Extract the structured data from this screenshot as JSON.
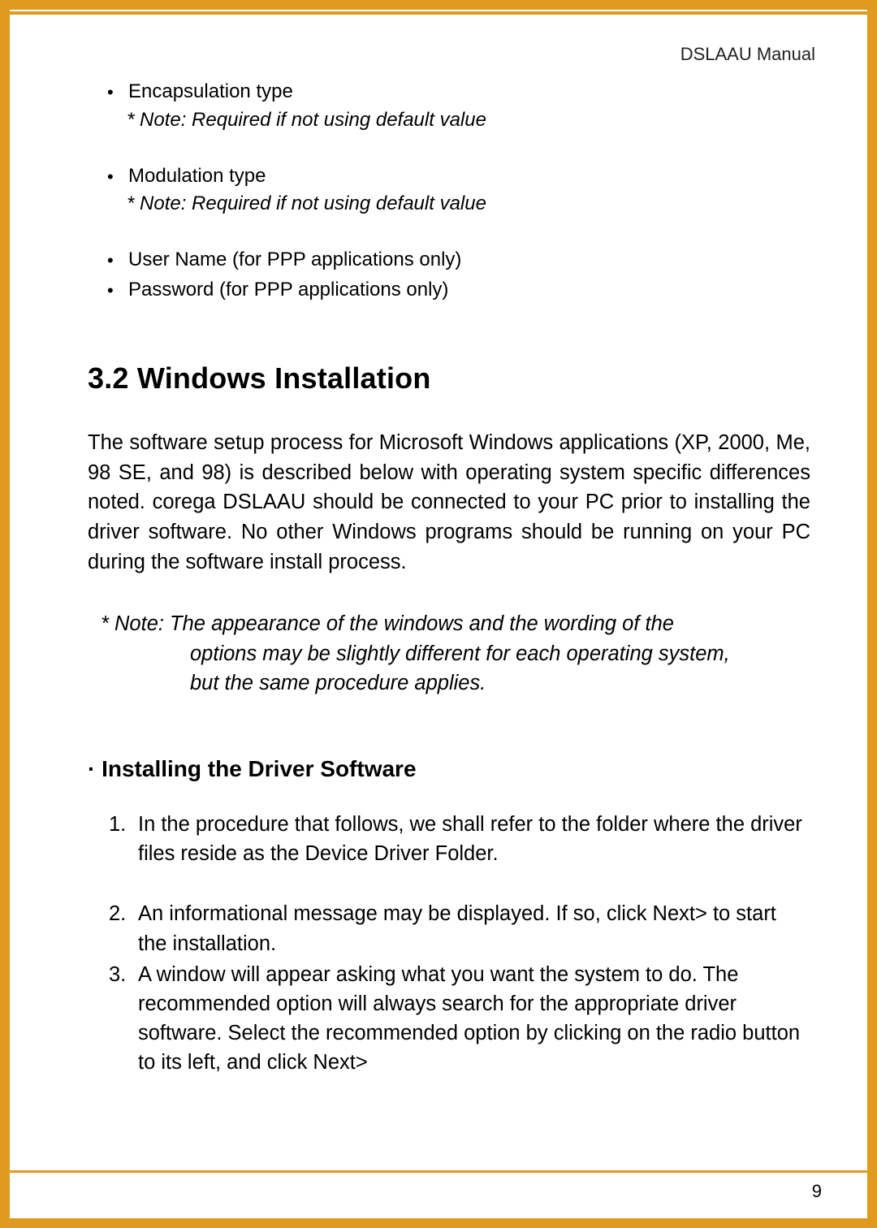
{
  "header": {
    "manual_title": "DSLAAU Manual"
  },
  "bullets": {
    "b1": "Encapsulation type",
    "n1": "* Note: Required if not using default value",
    "b2": "Modulation type",
    "n2": "* Note: Required if not using default value",
    "b3": "User Name (for PPP applications only)",
    "b4": "Password (for PPP applications only)"
  },
  "section": {
    "heading": "3.2 Windows Installation",
    "paragraph": "The software setup process for Microsoft Windows applications (XP, 2000, Me, 98 SE, and 98) is described below with operating system specific differences noted. corega DSLAAU should be connected to your PC prior to installing the driver software. No other Windows programs should be running on your PC during the software install process.",
    "note_first": "* Note: The appearance of the windows and the wording of the",
    "note_rest1": "options may be slightly different for each operating system,",
    "note_rest2": "but the same procedure applies."
  },
  "subsection": {
    "heading": "· Installing the Driver Software",
    "step1": "In the procedure that follows, we shall refer to the folder where the driver files reside as the Device Driver Folder.",
    "step2": "An informational message may be displayed. If so, click Next> to start the installation.",
    "step3": "A window will appear asking what you want the system to do. The recommended option will always search for the appropriate driver software. Select the recommended option by clicking on the radio button to its left, and click Next>"
  },
  "footer": {
    "page_number": "9"
  }
}
